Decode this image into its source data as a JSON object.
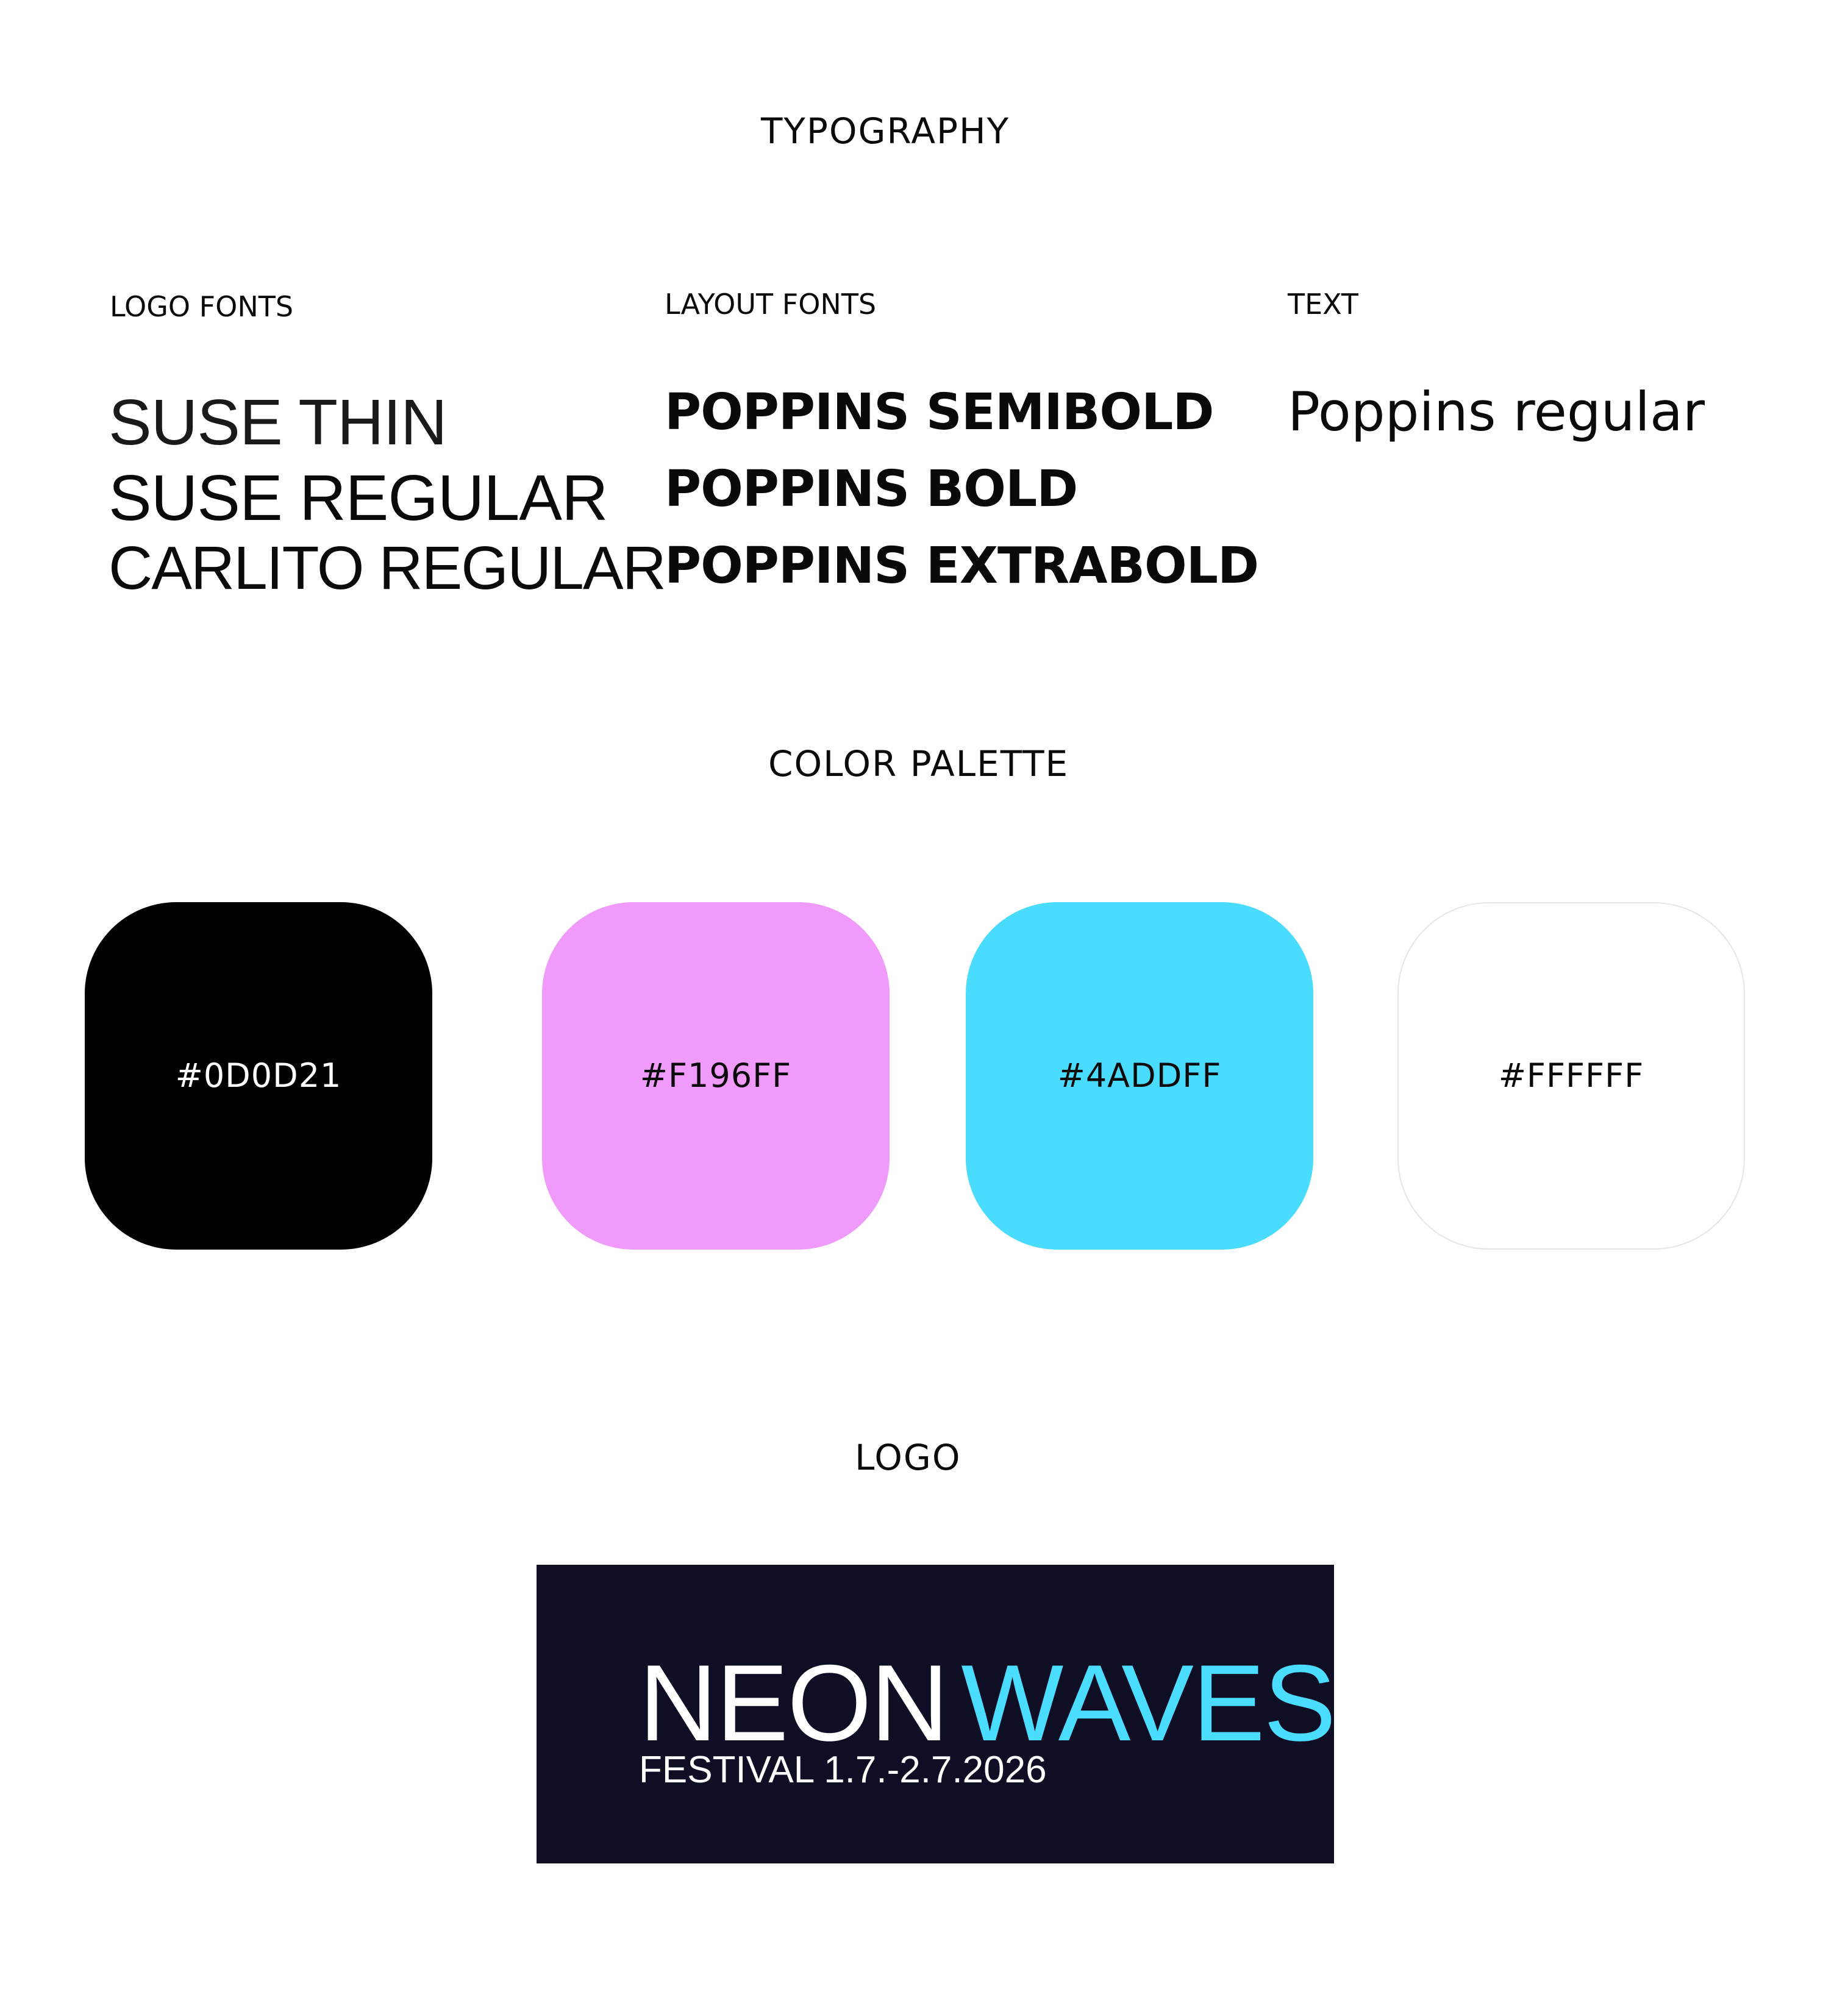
{
  "sections": {
    "typography_title": "TYPOGRAPHY",
    "color_palette_title": "COLOR PALETTE",
    "logo_title": "LOGO"
  },
  "typography": {
    "logo_fonts": {
      "label": "LOGO FONTS",
      "samples": [
        "SUSE THIN",
        "SUSE REGULAR",
        "CARLITO REGULAR"
      ]
    },
    "layout_fonts": {
      "label": "LAYOUT FONTS",
      "samples": [
        "POPPINS SEMIBOLD",
        "POPPINS BOLD",
        "POPPINS EXTRABOLD"
      ]
    },
    "text": {
      "label": "TEXT",
      "samples": [
        "Poppins regular"
      ]
    }
  },
  "palette": [
    {
      "hex": "#0D0D21",
      "fill": "#000000",
      "text_color": "#ffffff"
    },
    {
      "hex": "#F196FF",
      "fill": "#F09AFB",
      "text_color": "#0a0a0a"
    },
    {
      "hex": "#4ADDFF",
      "fill": "#4ADCFE",
      "text_color": "#0a0a0a"
    },
    {
      "hex": "#FFFFFF",
      "fill": "#FFFFFF",
      "text_color": "#0a0a0a"
    }
  ],
  "logo": {
    "word1": "NEON",
    "word2": "WAVES",
    "subtitle": "FESTIVAL 1.7.-2.7.2026",
    "background": "#0E0F24",
    "word1_color": "#ffffff",
    "word2_color": "#4ADDFF",
    "subtitle_color": "#ffffff"
  }
}
